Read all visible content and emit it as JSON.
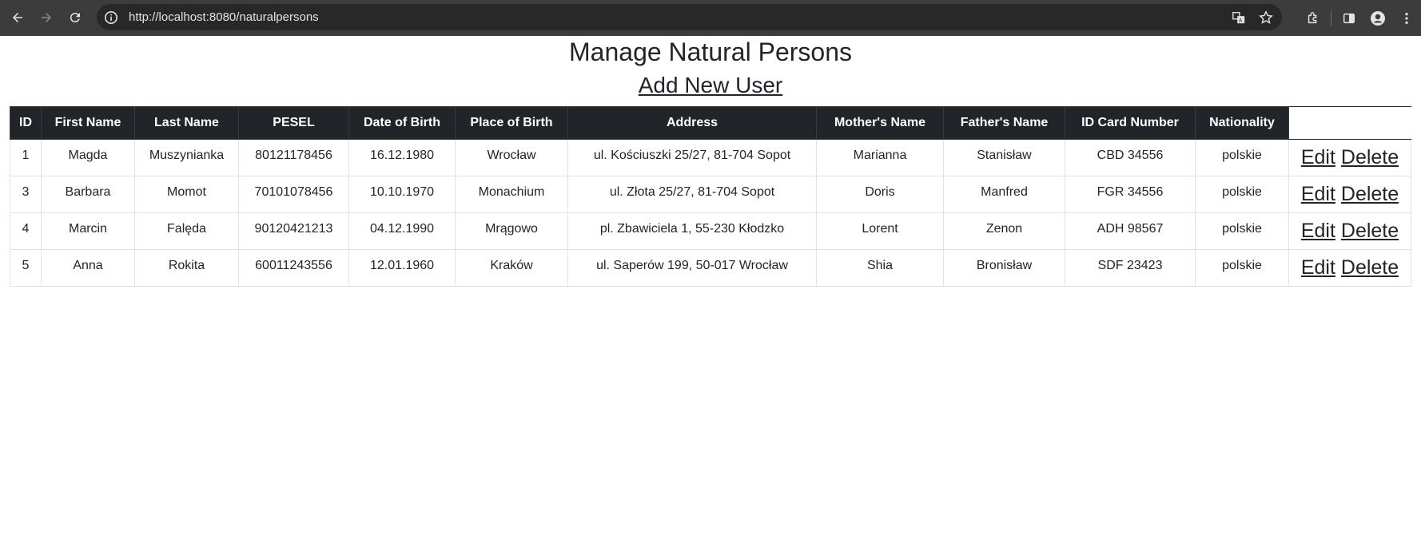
{
  "browser": {
    "url": "http://localhost:8080/naturalpersons"
  },
  "page": {
    "title": "Manage Natural Persons",
    "add_link": "Add New User"
  },
  "table": {
    "headers": [
      "ID",
      "First Name",
      "Last Name",
      "PESEL",
      "Date of Birth",
      "Place of Birth",
      "Address",
      "Mother's Name",
      "Father's Name",
      "ID Card Number",
      "Nationality"
    ],
    "rows": [
      [
        "1",
        "Magda",
        "Muszynianka",
        "80121178456",
        "16.12.1980",
        "Wrocław",
        "ul. Kościuszki 25/27, 81-704 Sopot",
        "Marianna",
        "Stanisław",
        "CBD 34556",
        "polskie"
      ],
      [
        "3",
        "Barbara",
        "Momot",
        "70101078456",
        "10.10.1970",
        "Monachium",
        "ul. Złota 25/27, 81-704 Sopot",
        "Doris",
        "Manfred",
        "FGR 34556",
        "polskie"
      ],
      [
        "4",
        "Marcin",
        "Falęda",
        "90120421213",
        "04.12.1990",
        "Mrągowo",
        "pl. Zbawiciela 1, 55-230 Kłodzko",
        "Lorent",
        "Zenon",
        "ADH 98567",
        "polskie"
      ],
      [
        "5",
        "Anna",
        "Rokita",
        "60011243556",
        "12.01.1960",
        "Kraków",
        "ul. Saperów 199, 50-017 Wrocław",
        "Shia",
        "Bronisław",
        "SDF 23423",
        "polskie"
      ]
    ],
    "actions": {
      "edit": "Edit",
      "delete": "Delete"
    }
  }
}
